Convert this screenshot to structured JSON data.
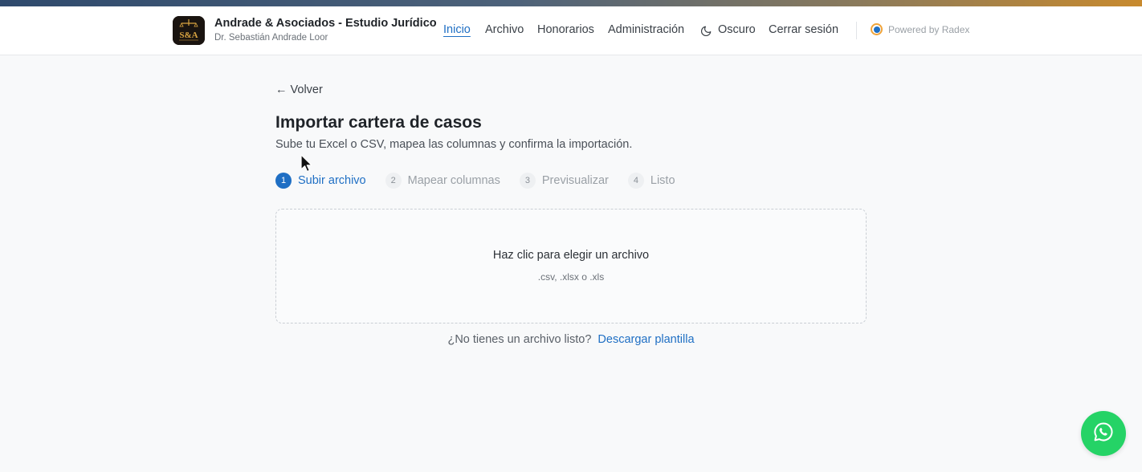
{
  "header": {
    "brand_name": "Andrade & Asociados - Estudio Jurídico",
    "brand_sub": "Dr. Sebastián Andrade Loor",
    "logo_text": "S&A",
    "nav": {
      "inicio": "Inicio",
      "archivo": "Archivo",
      "honorarios": "Honorarios",
      "administracion": "Administración",
      "theme": "Oscuro",
      "logout": "Cerrar sesión"
    },
    "powered_by": "Powered by Radex"
  },
  "page": {
    "back_label": "← Volver",
    "title": "Importar cartera de casos",
    "subtitle": "Sube tu Excel o CSV, mapea las columnas y confirma la importación."
  },
  "steps": [
    {
      "num": "1",
      "label": "Subir archivo",
      "active": true
    },
    {
      "num": "2",
      "label": "Mapear columnas",
      "active": false
    },
    {
      "num": "3",
      "label": "Previsualizar",
      "active": false
    },
    {
      "num": "4",
      "label": "Listo",
      "active": false
    }
  ],
  "dropzone": {
    "title": "Haz clic para elegir un archivo",
    "hint": ".csv, .xlsx o .xls"
  },
  "template": {
    "question": "¿No tienes un archivo listo?",
    "link": "Descargar plantilla"
  },
  "colors": {
    "accent": "#1f6fc4",
    "whatsapp": "#25d366",
    "background": "#f8f9fa"
  },
  "icons": {
    "theme": "moon-icon",
    "floating": "whatsapp-icon"
  }
}
